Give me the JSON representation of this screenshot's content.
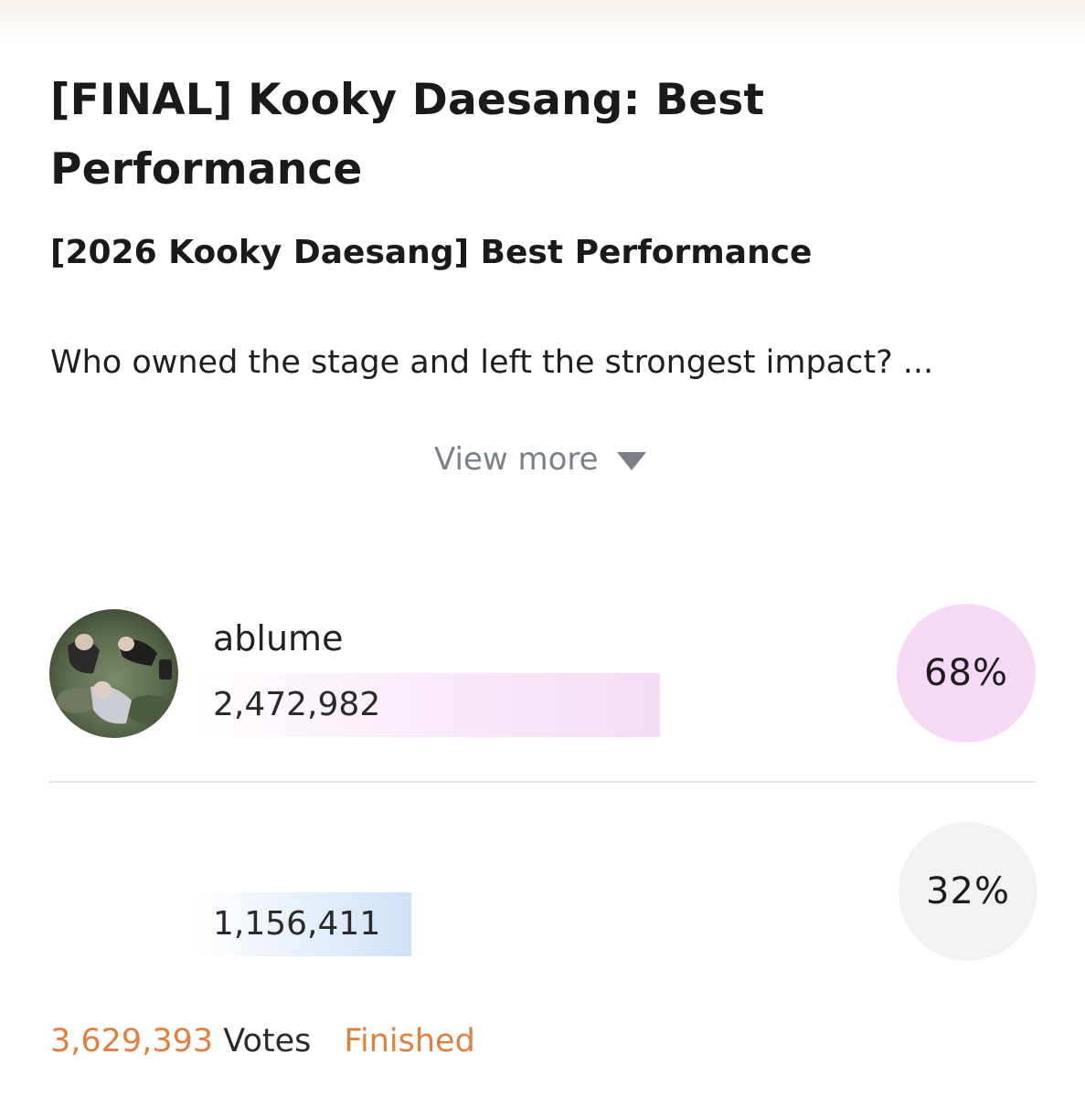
{
  "poll": {
    "title": "[FINAL] Kooky Daesang: Best Performance",
    "subtitle": "[2026 Kooky Daesang] Best Performance",
    "description": "Who owned the stage and left the strongest impact? ...",
    "view_more_label": "View more"
  },
  "candidates": [
    {
      "name": "ablume",
      "votes": "2,472,982",
      "percent_label": "68%",
      "bar_fraction": 0.68,
      "bar_color": "#f4dcf4",
      "badge_color": "#f5d9f5"
    },
    {
      "name": "",
      "votes": "1,156,411",
      "percent_label": "32%",
      "bar_fraction": 0.32,
      "bar_color": "#cfe1f8",
      "badge_color": "#f2f2f2"
    }
  ],
  "footer": {
    "total_votes": "3,629,393",
    "votes_label": "Votes",
    "status": "Finished"
  },
  "colors": {
    "accent": "#e07f42",
    "muted_text": "#7b8088"
  },
  "icons": {
    "view_more": "triangle-down-icon"
  }
}
